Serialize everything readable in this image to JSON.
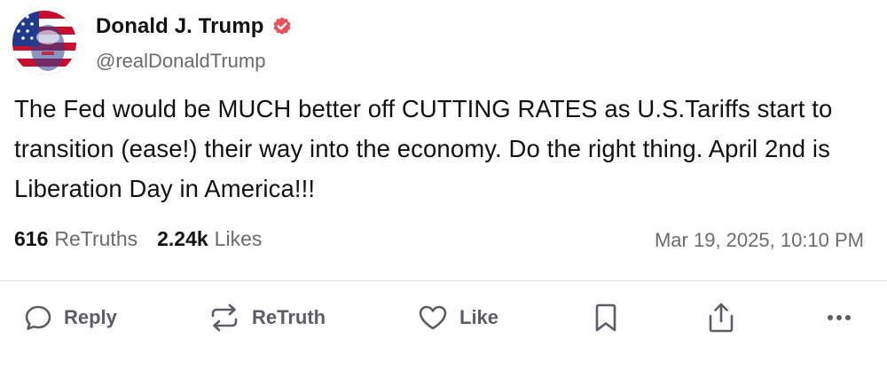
{
  "author": {
    "display_name": "Donald J. Trump",
    "handle": "@realDonaldTrump",
    "verified": true,
    "verified_badge_color": "#e8505b"
  },
  "post": {
    "text": "The Fed would be MUCH better off CUTTING RATES as U.S.Tariffs start to transition (ease!) their way into the economy. Do the right thing. April 2nd is Liberation Day in America!!!",
    "timestamp": "Mar 19, 2025, 10:10 PM"
  },
  "stats": {
    "retruths_count": "616",
    "retruths_label": "ReTruths",
    "likes_count": "2.24k",
    "likes_label": "Likes"
  },
  "actions": {
    "reply_label": "Reply",
    "retruth_label": "ReTruth",
    "like_label": "Like"
  },
  "icons": {
    "reply": "speech-bubble-icon",
    "retruth": "retruth-arrows-icon",
    "like": "heart-icon",
    "bookmark": "bookmark-icon",
    "share": "share-upload-icon",
    "more": "ellipsis-icon",
    "verified": "verified-badge-icon"
  },
  "colors": {
    "text_primary": "#111111",
    "text_secondary": "#6b6b6b",
    "action_color": "#5c5c66",
    "divider": "#e6e6e6"
  }
}
